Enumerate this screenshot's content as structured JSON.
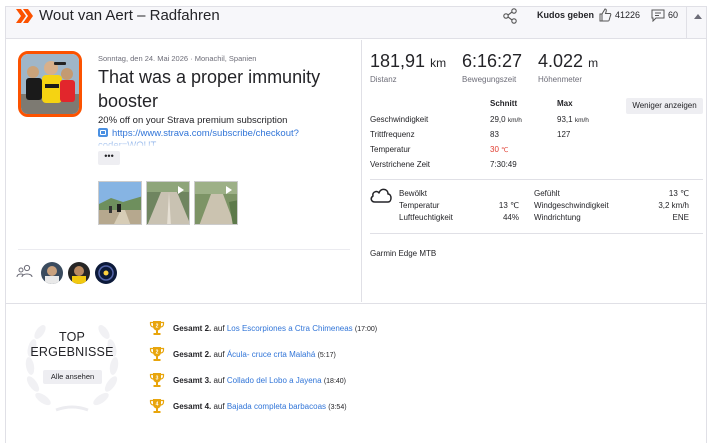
{
  "header": {
    "title": "Wout van Aert – Radfahren",
    "kudos_label": "Kudos geben",
    "kudos_count": "41226",
    "comment_count": "60"
  },
  "activity": {
    "meta": "Sonntag, den 24. Mai 2026 · Monachil, Spanien",
    "title": "That was a proper immunity booster",
    "description": "20% off on your Strava premium subscription",
    "link": "https://www.strava.com/subscribe/checkout?coder=WOUT",
    "more_label": "•••"
  },
  "stats": {
    "distance": {
      "value": "181,91",
      "unit": "km",
      "label": "Distanz"
    },
    "moving_time": {
      "value": "6:16:27",
      "label": "Bewegungszeit"
    },
    "elevation": {
      "value": "4.022",
      "unit": "m",
      "label": "Höhenmeter"
    }
  },
  "details": {
    "col_avg": "Schnitt",
    "col_max": "Max",
    "less_button": "Weniger anzeigen",
    "rows": [
      {
        "label": "Geschwindigkeit",
        "avg": "29,0",
        "avg_unit": "km/h",
        "max": "93,1",
        "max_unit": "km/h"
      },
      {
        "label": "Trittfrequenz",
        "avg": "83",
        "max": "127"
      },
      {
        "label": "Temperatur",
        "avg": "30",
        "avg_unit": "℃"
      },
      {
        "label": "Verstrichene Zeit",
        "avg": "7:30:49"
      }
    ]
  },
  "weather": {
    "condition": "Bewölkt",
    "temp_label": "Temperatur",
    "temp_value": "13 ℃",
    "humidity_label": "Luftfeuchtigkeit",
    "humidity_value": "44%",
    "feels_label": "Gefühlt",
    "feels_value": "13 ℃",
    "wind_speed_label": "Windgeschwindigkeit",
    "wind_speed_value": "3,2 km/h",
    "wind_dir_label": "Windrichtung",
    "wind_dir_value": "ENE"
  },
  "device": "Garmin Edge MTB",
  "top_results": {
    "title_line1": "TOP",
    "title_line2": "ERGEBNISSE",
    "all_button": "Alle ansehen",
    "items": [
      {
        "rank": "Gesamt 2.",
        "on": "auf",
        "segment": "Los Escorpiones a Ctra Chimeneas",
        "time": "(17:00)"
      },
      {
        "rank": "Gesamt 2.",
        "on": "auf",
        "segment": "Ácula- cruce crta Malahá",
        "time": "(5:17)"
      },
      {
        "rank": "Gesamt 3.",
        "on": "auf",
        "segment": "Collado del Lobo a Jayena",
        "time": "(18:40)"
      },
      {
        "rank": "Gesamt 4.",
        "on": "auf",
        "segment": "Bajada completa barbacoas",
        "time": "(3:54)"
      }
    ]
  },
  "colors": {
    "brand": "#fc5200",
    "link": "#3175d8",
    "hot": "#e03b2e",
    "trophy": "#e8a50c"
  },
  "icons": [
    "strava-chevron-icon",
    "share-icon",
    "thumbs-up-icon",
    "comment-icon",
    "cloud-icon",
    "group-icon",
    "trophy-icon",
    "video-play-icon",
    "wreath-icon"
  ]
}
